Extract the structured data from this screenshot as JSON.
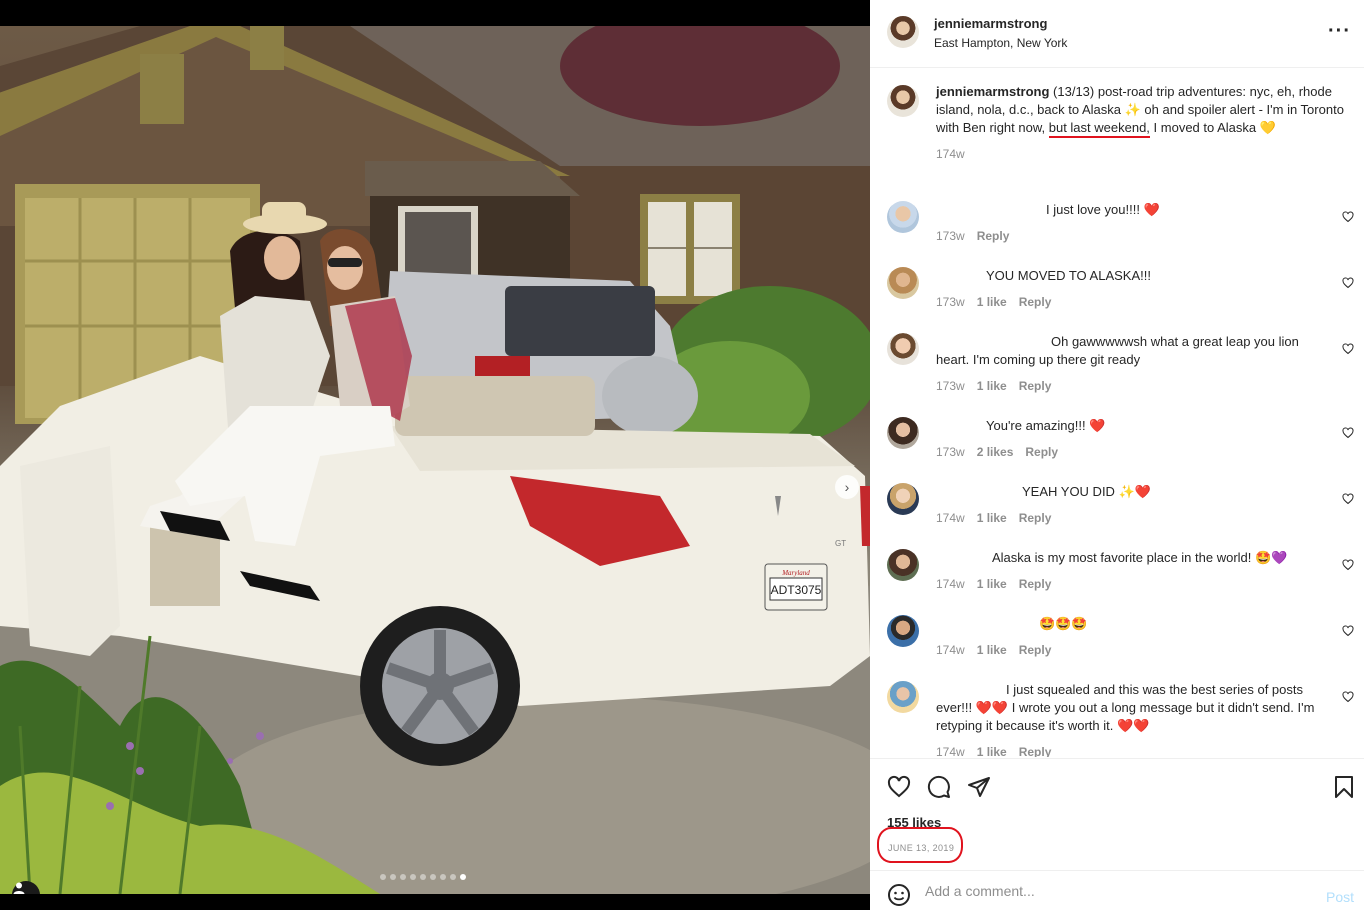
{
  "post": {
    "username": "jenniemarmstrong",
    "location": "East Hampton, New York",
    "caption_pre": "(13/13) post-road trip adventures: nyc, eh, rhode island, nola, d.c., back to Alaska ✨ oh and spoiler alert - I'm in Toronto with Ben right now, ",
    "caption_highlight": "but last weekend,",
    "caption_post": " I moved to Alaska 💛",
    "caption_age": "174w",
    "likes": "155 likes",
    "date": "JUNE 13, 2019"
  },
  "photo": {
    "plate": "ADT3075",
    "plate_state": "Maryland",
    "car_badge": "GT"
  },
  "comments": [
    {
      "text": "I just love you!!!! ❤️",
      "age": "173w",
      "likes": "",
      "reply": "Reply"
    },
    {
      "text": "YOU MOVED TO ALASKA!!!",
      "age": "173w",
      "likes": "1 like",
      "reply": "Reply"
    },
    {
      "text": "Oh gawwwwwsh what a great leap you lion heart. I'm coming up there git ready",
      "age": "173w",
      "likes": "1 like",
      "reply": "Reply"
    },
    {
      "text": "You're amazing!!! ❤️",
      "age": "173w",
      "likes": "2 likes",
      "reply": "Reply"
    },
    {
      "text": "YEAH YOU DID ✨❤️",
      "age": "174w",
      "likes": "1 like",
      "reply": "Reply"
    },
    {
      "text": "Alaska is my most favorite place in the world! 🤩💜",
      "age": "174w",
      "likes": "1 like",
      "reply": "Reply"
    },
    {
      "text": "🤩🤩🤩",
      "age": "174w",
      "likes": "1 like",
      "reply": "Reply"
    },
    {
      "text": "I just squealed and this was the best series of posts ever!!! ❤️❤️ I wrote you out a long message but it didn't send. I'm retyping it because it's worth it. ❤️❤️",
      "age": "174w",
      "likes": "1 like",
      "reply": "Reply"
    }
  ],
  "add_comment": {
    "placeholder": "Add a comment...",
    "post_label": "Post"
  },
  "icons": {
    "more": "more-options-icon",
    "like": "heart-icon",
    "comment": "comment-icon",
    "share": "share-icon",
    "save": "bookmark-icon",
    "emoji": "emoji-icon",
    "next": "chevron-right-icon",
    "tag": "user-tag-icon"
  },
  "colors": {
    "highlight": "#e0131e",
    "post_button": "#b2dffc"
  }
}
